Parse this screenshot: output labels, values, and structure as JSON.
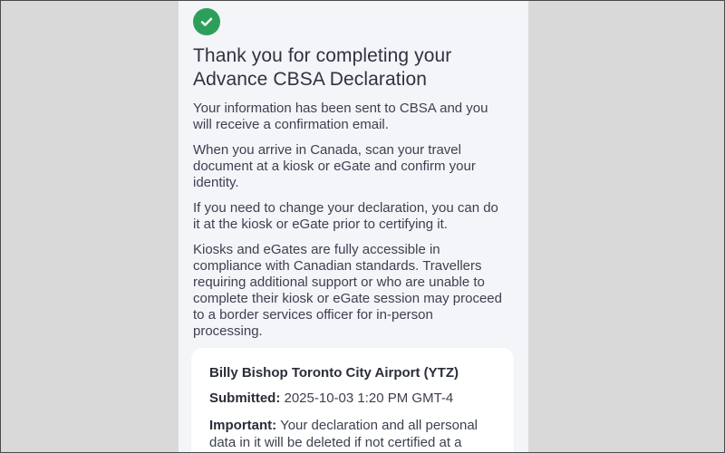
{
  "confirmation": {
    "status_icon": "check-circle",
    "accent_color": "#2e9f5b",
    "title": "Thank you for completing your Advance CBSA Declaration",
    "paragraphs": [
      "Your information has been sent to CBSA and you will receive a confirmation email.",
      "When you arrive in Canada, scan your travel document at a kiosk or eGate and confirm your identity.",
      "If you need to change your declaration, you can do it at the kiosk or eGate prior to certifying it.",
      "Kiosks and eGates are fully accessible in compliance with Canadian standards. Travellers requiring additional support or who are unable to complete their kiosk or eGate session may proceed to a border services officer for in-person processing."
    ]
  },
  "summary_card": {
    "airport": "Billy Bishop Toronto City Airport (YTZ)",
    "submitted_label": "Submitted:",
    "submitted_value": "2025-10-03 1:20 PM GMT-4",
    "important_label": "Important:",
    "important_text": "Your declaration and all personal data in it will be deleted if not certified at a"
  }
}
